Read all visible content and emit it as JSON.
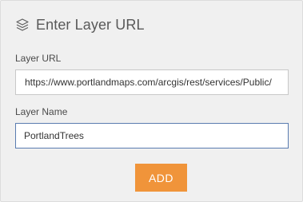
{
  "header": {
    "icon": "layers-icon",
    "title": "Enter Layer URL"
  },
  "form": {
    "layer_url_label": "Layer URL",
    "layer_url_value": "https://www.portlandmaps.com/arcgis/rest/services/Public/",
    "layer_name_label": "Layer Name",
    "layer_name_value": "PortlandTrees"
  },
  "actions": {
    "add_label": "ADD"
  },
  "colors": {
    "panel_bg": "#f0f0f0",
    "accent": "#f0943a",
    "focus_border": "#5a7cb0"
  }
}
